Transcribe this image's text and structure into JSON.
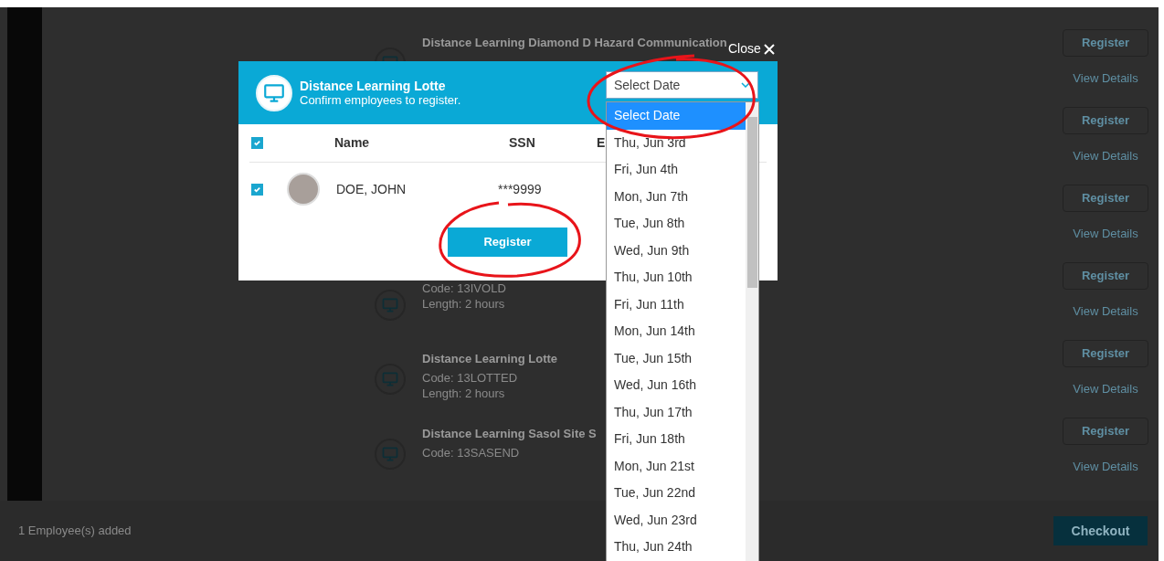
{
  "page": {
    "courses": [
      {
        "title": "Distance Learning Diamond D Hazard Communication"
      },
      {
        "code": "Code: 13IVOLD",
        "length": "Length: 2 hours"
      },
      {
        "title": "Distance Learning Lotte",
        "code": "Code: 13LOTTED",
        "length": "Length: 2 hours"
      },
      {
        "title": "Distance Learning Sasol Site S",
        "code": "Code: 13SASEND"
      }
    ],
    "actions": [
      {
        "register": "Register",
        "details": "View Details"
      },
      {
        "register": "Register",
        "details": "View Details"
      },
      {
        "register": "Register",
        "details": "View Details"
      },
      {
        "register": "Register",
        "details": "View Details"
      },
      {
        "register": "Register",
        "details": "View Details"
      },
      {
        "register": "Register",
        "details": "View Details"
      }
    ],
    "footer": {
      "count": "1 Employee(s) added",
      "checkout": "Checkout"
    }
  },
  "modal": {
    "close": "Close",
    "title": "Distance Learning Lotte",
    "subtitle": "Confirm employees to register.",
    "date_select": {
      "value": "Select Date",
      "expanded": true
    },
    "options": [
      {
        "label": "Select Date",
        "selected": true
      },
      {
        "label": "Thu, Jun 3rd",
        "selected": false
      },
      {
        "label": "Fri, Jun 4th",
        "selected": false
      },
      {
        "label": "Mon, Jun 7th",
        "selected": false
      },
      {
        "label": "Tue, Jun 8th",
        "selected": false
      },
      {
        "label": "Wed, Jun 9th",
        "selected": false
      },
      {
        "label": "Thu, Jun 10th",
        "selected": false
      },
      {
        "label": "Fri, Jun 11th",
        "selected": false
      },
      {
        "label": "Mon, Jun 14th",
        "selected": false
      },
      {
        "label": "Tue, Jun 15th",
        "selected": false
      },
      {
        "label": "Wed, Jun 16th",
        "selected": false
      },
      {
        "label": "Thu, Jun 17th",
        "selected": false
      },
      {
        "label": "Fri, Jun 18th",
        "selected": false
      },
      {
        "label": "Mon, Jun 21st",
        "selected": false
      },
      {
        "label": "Tue, Jun 22nd",
        "selected": false
      },
      {
        "label": "Wed, Jun 23rd",
        "selected": false
      },
      {
        "label": "Thu, Jun 24th",
        "selected": false
      }
    ],
    "all_checked": true,
    "columns": [
      "Name",
      "SSN",
      "E"
    ],
    "rows": [
      {
        "name": "DOE, JOHN",
        "ssn": "***9999",
        "checked": true
      }
    ],
    "register": "Register"
  }
}
